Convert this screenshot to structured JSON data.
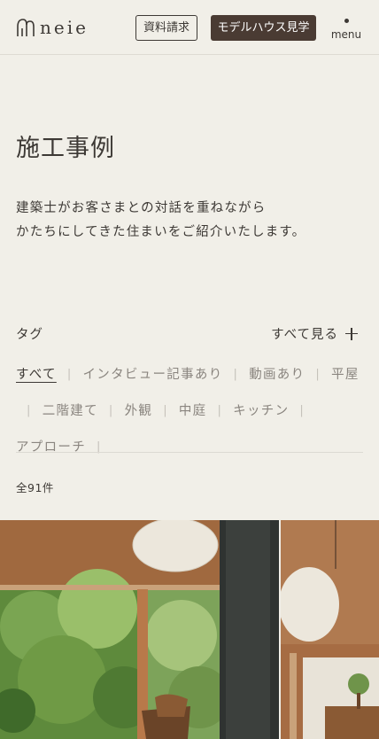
{
  "header": {
    "logo_text": "neie",
    "request_button": "資料請求",
    "model_house_button": "モデルハウス見学",
    "menu_label": "menu"
  },
  "page": {
    "title": "施工事例",
    "lead_line1": "建築士がお客さまとの対話を重ねながら",
    "lead_line2": "かたちにしてきた住まいをご紹介いたします。"
  },
  "tags": {
    "heading": "タグ",
    "see_all": "すべて見る",
    "items": [
      {
        "label": "すべて",
        "active": true
      },
      {
        "label": "インタビュー記事あり",
        "active": false
      },
      {
        "label": "動画あり",
        "active": false
      },
      {
        "label": "平屋",
        "active": false
      },
      {
        "label": "二階建て",
        "active": false
      },
      {
        "label": "外観",
        "active": false
      },
      {
        "label": "中庭",
        "active": false
      },
      {
        "label": "キッチン",
        "active": false
      },
      {
        "label": "アプローチ",
        "active": false
      }
    ],
    "separator": "|"
  },
  "results": {
    "count_text": "全91件"
  },
  "colors": {
    "background": "#f1efe8",
    "text": "#3d3935",
    "accent_button": "#4a3b33",
    "muted_text": "#8a857f"
  }
}
